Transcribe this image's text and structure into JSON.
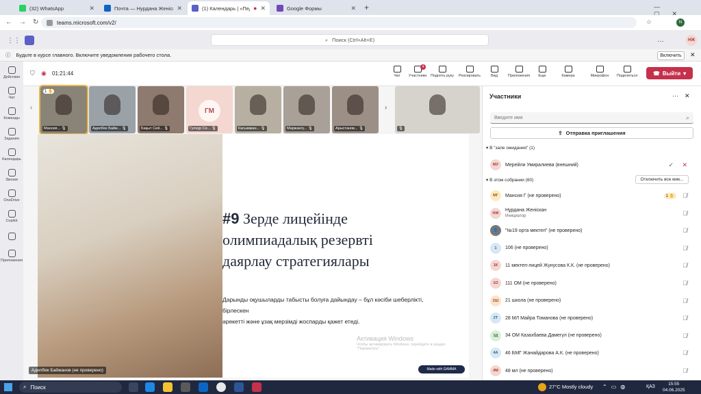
{
  "browser": {
    "tabs": [
      {
        "label": "(32) WhatsApp",
        "color": "#25d366",
        "active": false
      },
      {
        "label": "Почта — Нурдана Женіскан — ...",
        "color": "#0a66c2",
        "active": false
      },
      {
        "label": "(1) Календарь | «Педагоги...",
        "color": "#5b5fc7",
        "active": true
      },
      {
        "label": "Google Формы",
        "color": "#7248b9",
        "active": false
      }
    ],
    "url": "teams.microsoft.com/v2/"
  },
  "teams": {
    "search_placeholder": "Поиск (Ctrl+Alt+E)",
    "avatar": "НЖ",
    "notification": "Будьте в курсе главного. Включите уведомления рабочего стола.",
    "notification_button": "Включить"
  },
  "rail": [
    {
      "label": "Действия",
      "icon": "bell-icon"
    },
    {
      "label": "Чат",
      "icon": "chat-icon"
    },
    {
      "label": "Команды",
      "icon": "teams-icon"
    },
    {
      "label": "Задания",
      "icon": "assignments-icon"
    },
    {
      "label": "Календарь",
      "icon": "calendar-icon"
    },
    {
      "label": "Звонки",
      "icon": "phone-icon"
    },
    {
      "label": "OneDrive",
      "icon": "cloud-icon"
    },
    {
      "label": "Copilot",
      "icon": "copilot-icon"
    },
    {
      "label": "",
      "icon": "more-icon"
    },
    {
      "label": "Приложения",
      "icon": "apps-icon"
    }
  ],
  "meeting": {
    "timer": "01:21:44",
    "tools": [
      {
        "label": "Чат",
        "icon": "chat-icon"
      },
      {
        "label": "Участники",
        "icon": "people-icon",
        "badge": "4"
      },
      {
        "label": "Поднять руку",
        "icon": "hand-icon"
      },
      {
        "label": "Реагировать",
        "icon": "emoji-icon"
      },
      {
        "label": "Вид",
        "icon": "view-icon"
      },
      {
        "label": "Приложения",
        "icon": "apps-icon"
      },
      {
        "label": "Еще",
        "icon": "more-icon"
      },
      {
        "label": "Камера",
        "icon": "camera-icon"
      },
      {
        "label": "Микрофон",
        "icon": "mic-icon"
      },
      {
        "label": "Поделиться",
        "icon": "share-icon"
      }
    ],
    "leave": "Выйти"
  },
  "tiles": [
    {
      "name": "Мансия...",
      "hand": "1",
      "bg": "#8a8478"
    },
    {
      "name": "Адилбек Байж...",
      "bg": "#9aa2a8"
    },
    {
      "name": "Бақыт Сей...",
      "bg": "#8e7a6e"
    },
    {
      "name": "Гулнур Се...",
      "initials": "ГМ",
      "bg": "#f3d7d0"
    },
    {
      "name": "Касымжан...",
      "bg": "#b7b0a2"
    },
    {
      "name": "Маржангу...",
      "bg": "#a9a097"
    },
    {
      "name": "Арыстанов...",
      "bg": "#9c8f86"
    },
    {
      "name": "",
      "bg": "#d6d3cc"
    }
  ],
  "slide": {
    "number": "#9",
    "title_l1": "Зерде лицейінде",
    "title_l2": "олимпиадалық резервті",
    "title_l3": "даярлау стратегиялары",
    "body_l1": "Дарынды оқушыларды табысты болуға дайындау – бұл кәсіби шеберлікті, бірлескен",
    "body_l2": "әрекетті және ұзақ мерзімді жоспарды қажет етеді.",
    "watermark": "Активация Windows",
    "watermark_sub": "Чтобы активировать Windows, перейдите в раздел \"Параметры\".",
    "badge": "Made with GAMMA",
    "presenter": "Адилбек Байжанов (не проверено)"
  },
  "participants": {
    "title": "Участники",
    "search_placeholder": "Введите имя",
    "invite": "Отправка приглашения",
    "lobby_header": "В \"зале ожидания\" (1)",
    "lobby": [
      {
        "initials": "МУ",
        "name": "Мерейли Умиралиева (внешний)",
        "color": "#f3d7d0",
        "fg": "#a33"
      }
    ],
    "in_meeting_header": "В этом собрании (60)",
    "mute_all": "Отключить все мик...",
    "people": [
      {
        "initials": "МГ",
        "name": "Мансия Г (не проверено)",
        "color": "#fde9c4",
        "fg": "#8a5a00",
        "extra": "1"
      },
      {
        "initials": "НЖ",
        "name": "Нұрдана Женіскан",
        "sub": "Инициатор",
        "color": "#f3d7d0",
        "fg": "#a33"
      },
      {
        "initials": "👤",
        "name": "\"№19 орта мектеп\" (не проверено)",
        "color": "#777",
        "fg": "#fff"
      },
      {
        "initials": "1",
        "name": "106 (не проверено)",
        "color": "#d6e8f5",
        "fg": "#2a6090"
      },
      {
        "initials": "1К",
        "name": "11 мектеп-лицей Жунусова К.К. (не проверено)",
        "color": "#f3d7d0",
        "fg": "#a33"
      },
      {
        "initials": "1О",
        "name": "111 ОМ (не проверено)",
        "color": "#f3d7d0",
        "fg": "#a33"
      },
      {
        "initials": "2Ш",
        "name": "21 школа (не проверено)",
        "color": "#fde2cc",
        "fg": "#a05010"
      },
      {
        "initials": "2Т",
        "name": "28 МЛ Майра Томанова (не проверено)",
        "color": "#d6e8f5",
        "fg": "#2a6090"
      },
      {
        "initials": "3Д",
        "name": "34 ОМ Казахбаева Дамегул (не проверено)",
        "color": "#d9efd9",
        "fg": "#2d7a2d"
      },
      {
        "initials": "4А",
        "name": "46 БМГ Жанайдарова А.К. (не проверено)",
        "color": "#d6e8f5",
        "fg": "#2a6090"
      },
      {
        "initials": "4М",
        "name": "48 мл (не проверено)",
        "color": "#f3d7d0",
        "fg": "#a33"
      }
    ]
  },
  "taskbar": {
    "search": "Поиск",
    "weather": "27°C  Mostly cloudy",
    "lang": "ҚАЗ",
    "time": "15:55",
    "date": "04.06.2025"
  }
}
